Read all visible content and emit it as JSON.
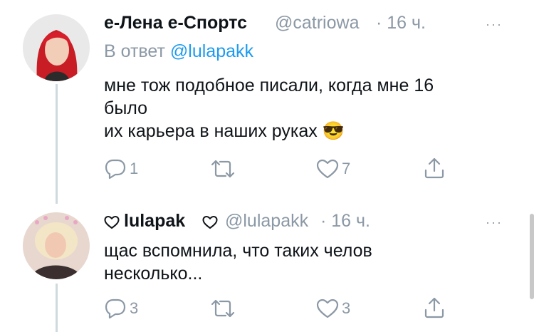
{
  "tweets": [
    {
      "display_name": "е-Лена е-Спортс",
      "handle": "@catriowa",
      "time": "· 16 ч.",
      "reply_prefix": "В ответ",
      "reply_to": "@lulapakk",
      "lines": [
        "мне тож подобное писали, когда мне 16",
        "было",
        "их карьера в наших руках"
      ],
      "emoji": "😎",
      "reply_count": "1",
      "retweet_count": "",
      "like_count": "7"
    },
    {
      "display_name": "lulapak",
      "handle": "@lulapakk",
      "time": "· 16 ч.",
      "lines": [
        "щас вспомнила, что таких челов",
        "несколько..."
      ],
      "reply_count": "3",
      "retweet_count": "",
      "like_count": "3"
    }
  ],
  "more_glyph": "···"
}
